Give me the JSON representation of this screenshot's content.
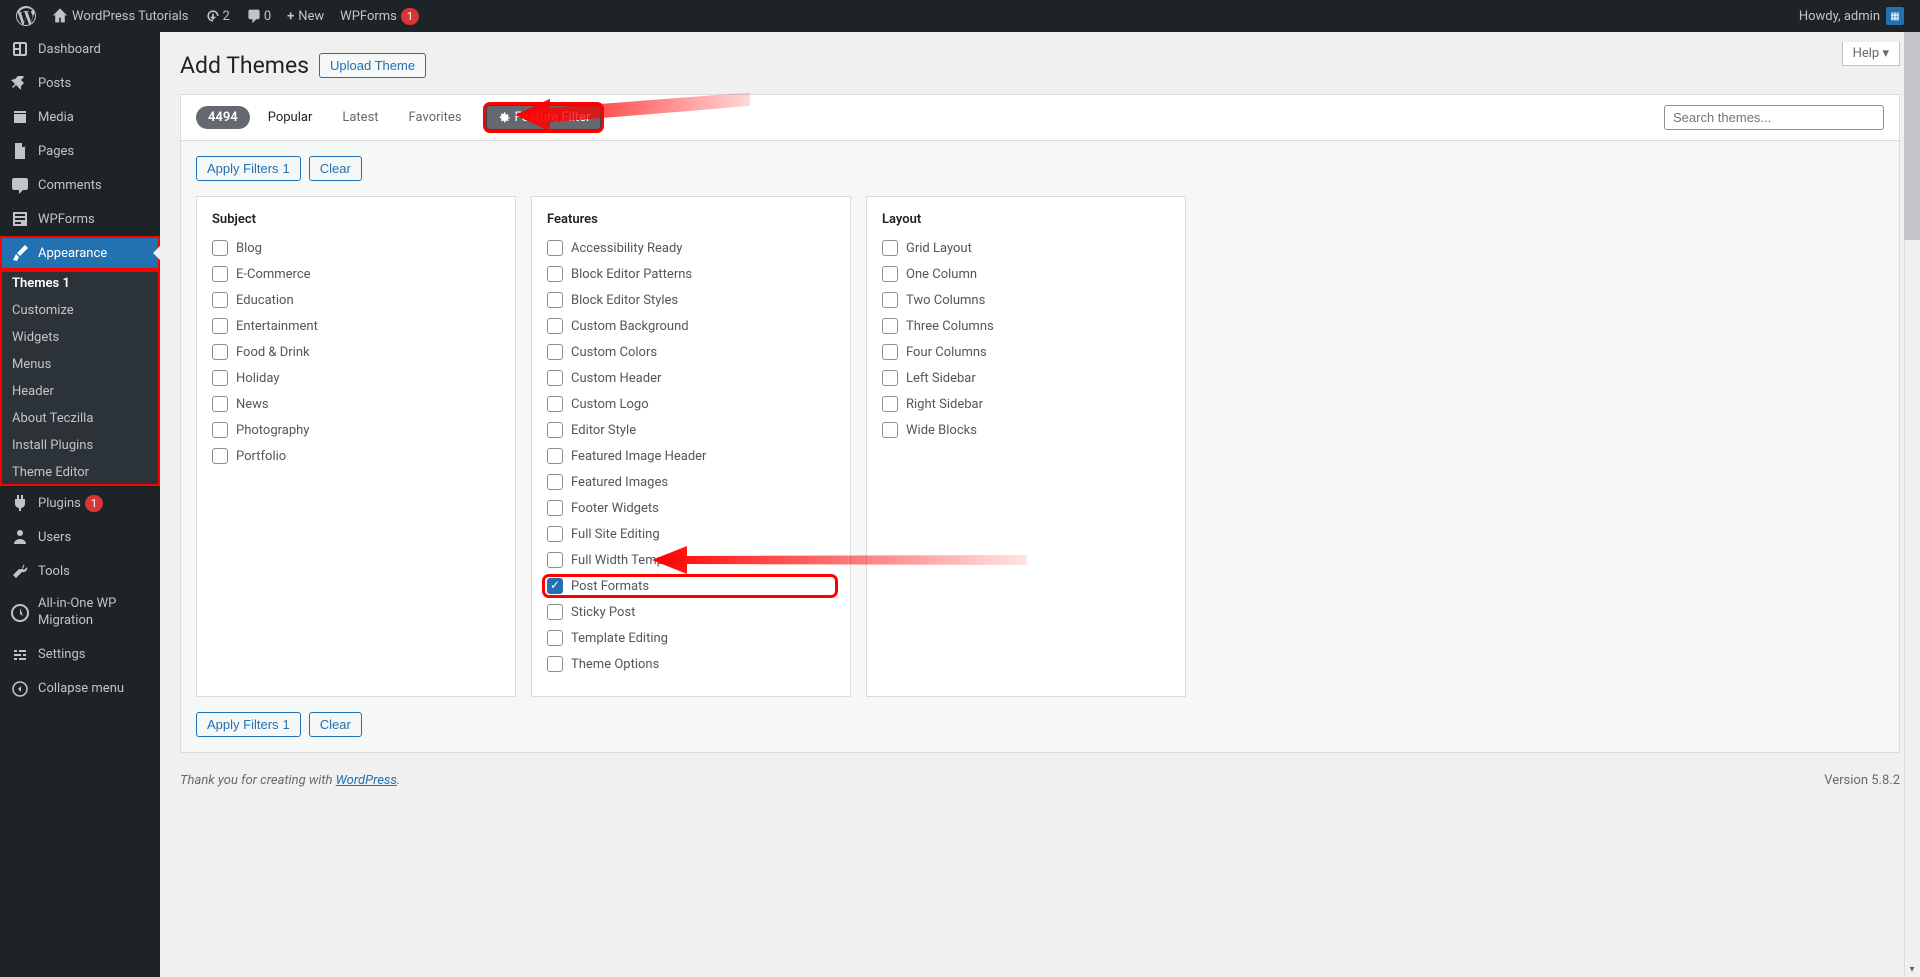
{
  "adminbar": {
    "site_name": "WordPress Tutorials",
    "updates": "2",
    "comments": "0",
    "new_label": "New",
    "wpforms_label": "WPForms",
    "wpforms_badge": "1",
    "howdy": "Howdy, admin"
  },
  "sidebar": {
    "dashboard": "Dashboard",
    "posts": "Posts",
    "media": "Media",
    "pages": "Pages",
    "comments": "Comments",
    "wpforms": "WPForms",
    "appearance": "Appearance",
    "appearance_sub": {
      "themes": "Themes",
      "themes_badge": "1",
      "customize": "Customize",
      "widgets": "Widgets",
      "menus": "Menus",
      "header": "Header",
      "about": "About Teczilla",
      "install_plugins": "Install Plugins",
      "theme_editor": "Theme Editor"
    },
    "plugins": "Plugins",
    "plugins_badge": "1",
    "users": "Users",
    "tools": "Tools",
    "aio": "All-in-One WP Migration",
    "settings": "Settings",
    "collapse": "Collapse menu"
  },
  "page": {
    "title": "Add Themes",
    "upload": "Upload Theme",
    "help": "Help"
  },
  "filterbar": {
    "count": "4494",
    "popular": "Popular",
    "latest": "Latest",
    "favorites": "Favorites",
    "feature_filter": "Feature Filter",
    "search_placeholder": "Search themes..."
  },
  "actions": {
    "apply": "Apply Filters",
    "apply_count": "1",
    "clear": "Clear"
  },
  "columns": {
    "subject": {
      "title": "Subject",
      "items": [
        "Blog",
        "E-Commerce",
        "Education",
        "Entertainment",
        "Food & Drink",
        "Holiday",
        "News",
        "Photography",
        "Portfolio"
      ]
    },
    "features": {
      "title": "Features",
      "items": [
        "Accessibility Ready",
        "Block Editor Patterns",
        "Block Editor Styles",
        "Custom Background",
        "Custom Colors",
        "Custom Header",
        "Custom Logo",
        "Editor Style",
        "Featured Image Header",
        "Featured Images",
        "Footer Widgets",
        "Full Site Editing",
        "Full Width Template",
        "Post Formats",
        "Sticky Post",
        "Template Editing",
        "Theme Options"
      ],
      "checked": "Post Formats"
    },
    "layout": {
      "title": "Layout",
      "items": [
        "Grid Layout",
        "One Column",
        "Two Columns",
        "Three Columns",
        "Four Columns",
        "Left Sidebar",
        "Right Sidebar",
        "Wide Blocks"
      ]
    }
  },
  "footer": {
    "thanks_pre": "Thank you for creating with ",
    "wp": "WordPress",
    "thanks_post": ".",
    "version": "Version 5.8.2"
  }
}
